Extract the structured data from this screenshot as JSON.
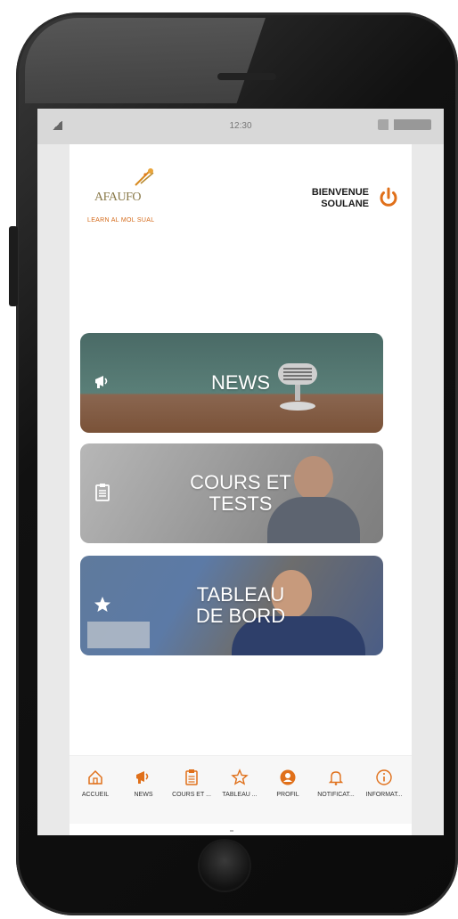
{
  "status_bar": {
    "time": "12:30"
  },
  "header": {
    "logo_text": "AFAUFO",
    "logo_subtext": "LEARN AL MOL SUAL",
    "welcome_line1": "BIENVENUE",
    "welcome_line2": "SOULANE"
  },
  "cards": [
    {
      "title_line1": "NEWS",
      "title_line2": "",
      "icon": "megaphone-icon"
    },
    {
      "title_line1": "COURS ET",
      "title_line2": "TESTS",
      "icon": "clipboard-icon"
    },
    {
      "title_line1": "TABLEAU",
      "title_line2": "DE BORD",
      "icon": "star-icon"
    }
  ],
  "bottom_nav": [
    {
      "label": "ACCUEIL",
      "icon": "home-icon"
    },
    {
      "label": "NEWS",
      "icon": "megaphone-icon"
    },
    {
      "label": "COURS ET ...",
      "icon": "clipboard-icon"
    },
    {
      "label": "TABLEAU ...",
      "icon": "star-icon"
    },
    {
      "label": "PROFIL",
      "icon": "profile-icon"
    },
    {
      "label": "NOTIFICAT...",
      "icon": "bell-icon"
    },
    {
      "label": "INFORMAT...",
      "icon": "info-icon"
    }
  ],
  "colors": {
    "accent": "#e0701a",
    "card_text": "#ffffff"
  }
}
